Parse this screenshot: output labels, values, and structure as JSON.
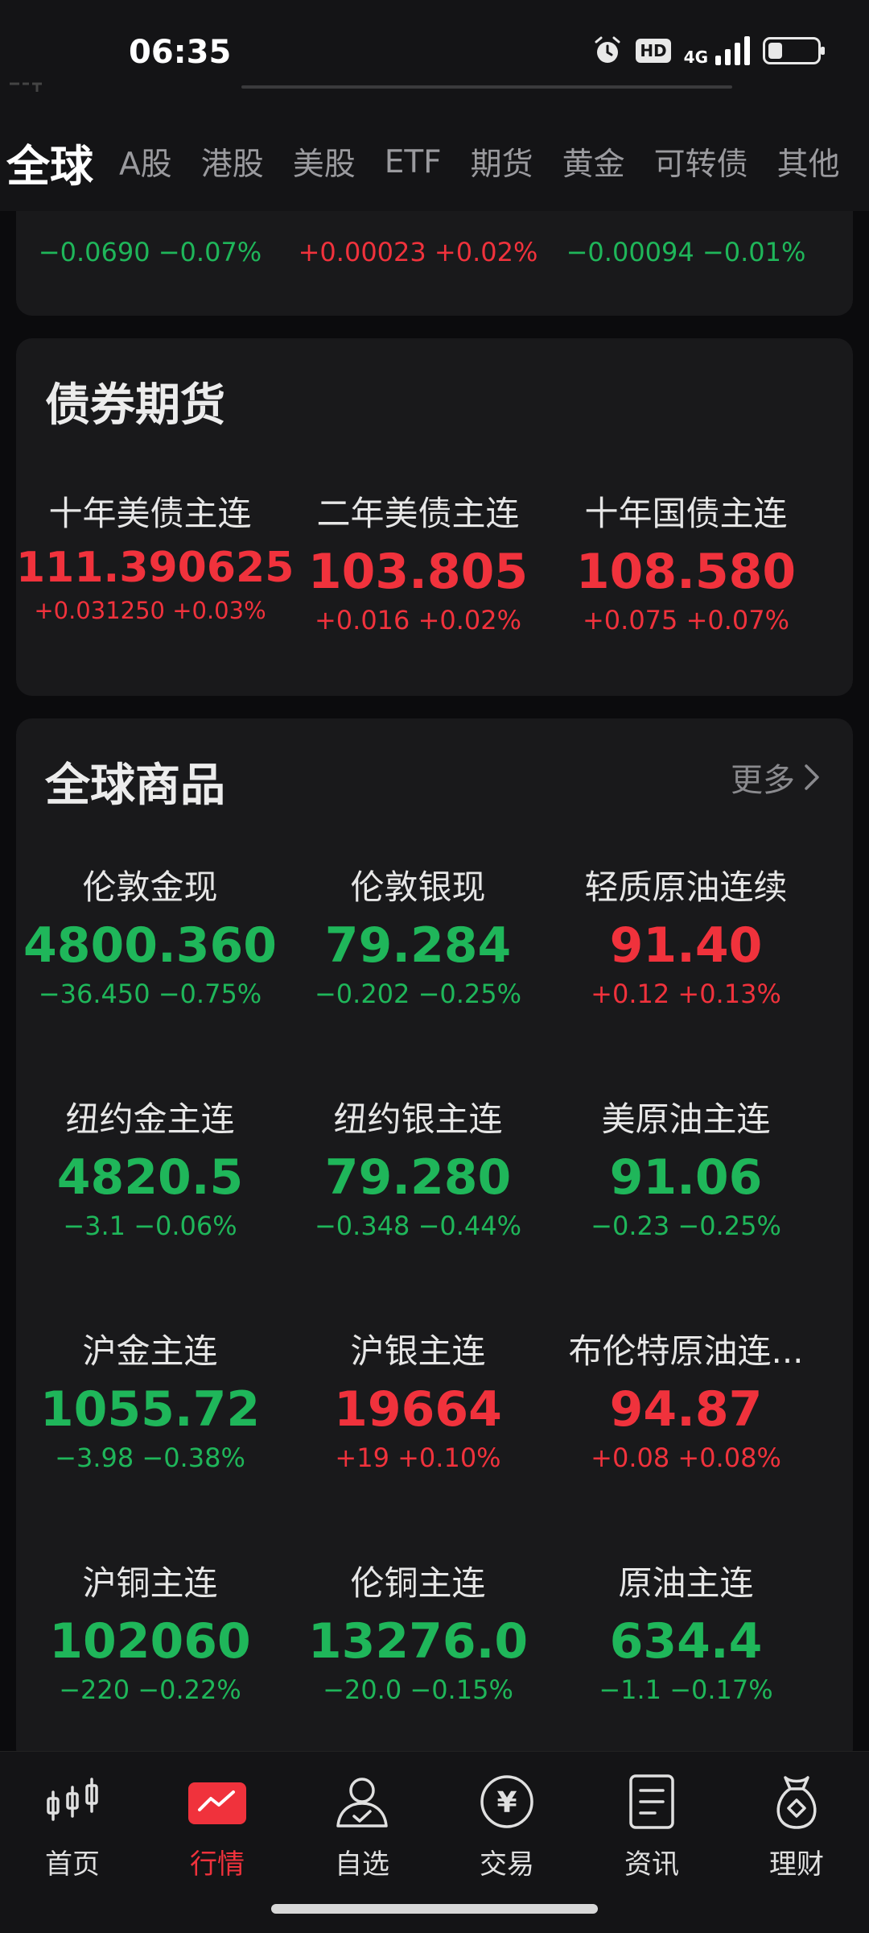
{
  "status_bar": {
    "time": "06:35",
    "network": "4G",
    "hd": "HD",
    "battery_level": 0.3
  },
  "tabs": [
    "全球",
    "A股",
    "港股",
    "美股",
    "ETF",
    "期货",
    "黄金",
    "可转债",
    "其他"
  ],
  "active_tab": 0,
  "top_partial": {
    "quotes": [
      {
        "change": "−0.0690 −0.07%",
        "dir": "down"
      },
      {
        "change": "+0.00023 +0.02%",
        "dir": "up"
      },
      {
        "change": "−0.00094 −0.01%",
        "dir": "down"
      }
    ]
  },
  "bond_futures": {
    "title": "债券期货",
    "quotes": [
      {
        "name": "十年美债主连",
        "price": "111.390625",
        "change": "+0.031250 +0.03%",
        "dir": "up"
      },
      {
        "name": "二年美债主连",
        "price": "103.805",
        "change": "+0.016 +0.02%",
        "dir": "up"
      },
      {
        "name": "十年国债主连",
        "price": "108.580",
        "change": "+0.075 +0.07%",
        "dir": "up"
      }
    ]
  },
  "global_commodities": {
    "title": "全球商品",
    "more_label": "更多",
    "quotes": [
      {
        "name": "伦敦金现",
        "price": "4800.360",
        "change": "−36.450 −0.75%",
        "dir": "down"
      },
      {
        "name": "伦敦银现",
        "price": "79.284",
        "change": "−0.202 −0.25%",
        "dir": "down"
      },
      {
        "name": "轻质原油连续",
        "price": "91.40",
        "change": "+0.12 +0.13%",
        "dir": "up"
      },
      {
        "name": "纽约金主连",
        "price": "4820.5",
        "change": "−3.1 −0.06%",
        "dir": "down"
      },
      {
        "name": "纽约银主连",
        "price": "79.280",
        "change": "−0.348 −0.44%",
        "dir": "down"
      },
      {
        "name": "美原油主连",
        "price": "91.06",
        "change": "−0.23 −0.25%",
        "dir": "down"
      },
      {
        "name": "沪金主连",
        "price": "1055.72",
        "change": "−3.98 −0.38%",
        "dir": "down"
      },
      {
        "name": "沪银主连",
        "price": "19664",
        "change": "+19 +0.10%",
        "dir": "up"
      },
      {
        "name": "布伦特原油连...",
        "price": "94.87",
        "change": "+0.08 +0.08%",
        "dir": "up"
      },
      {
        "name": "沪铜主连",
        "price": "102060",
        "change": "−220 −0.22%",
        "dir": "down"
      },
      {
        "name": "伦铜主连",
        "price": "13276.0",
        "change": "−20.0 −0.15%",
        "dir": "down"
      },
      {
        "name": "原油主连",
        "price": "634.4",
        "change": "−1.1 −0.17%",
        "dir": "down"
      }
    ]
  },
  "bottom_nav": [
    {
      "label": "首页",
      "icon": "candlestick-icon"
    },
    {
      "label": "行情",
      "icon": "market-chart-icon"
    },
    {
      "label": "自选",
      "icon": "user-check-icon"
    },
    {
      "label": "交易",
      "icon": "yen-circle-icon"
    },
    {
      "label": "资讯",
      "icon": "document-icon"
    },
    {
      "label": "理财",
      "icon": "money-bag-icon"
    }
  ],
  "active_nav": 1,
  "colors": {
    "up": "#f0323c",
    "down": "#1fb65a",
    "background": "#0b0b0d",
    "card": "#19191b"
  }
}
